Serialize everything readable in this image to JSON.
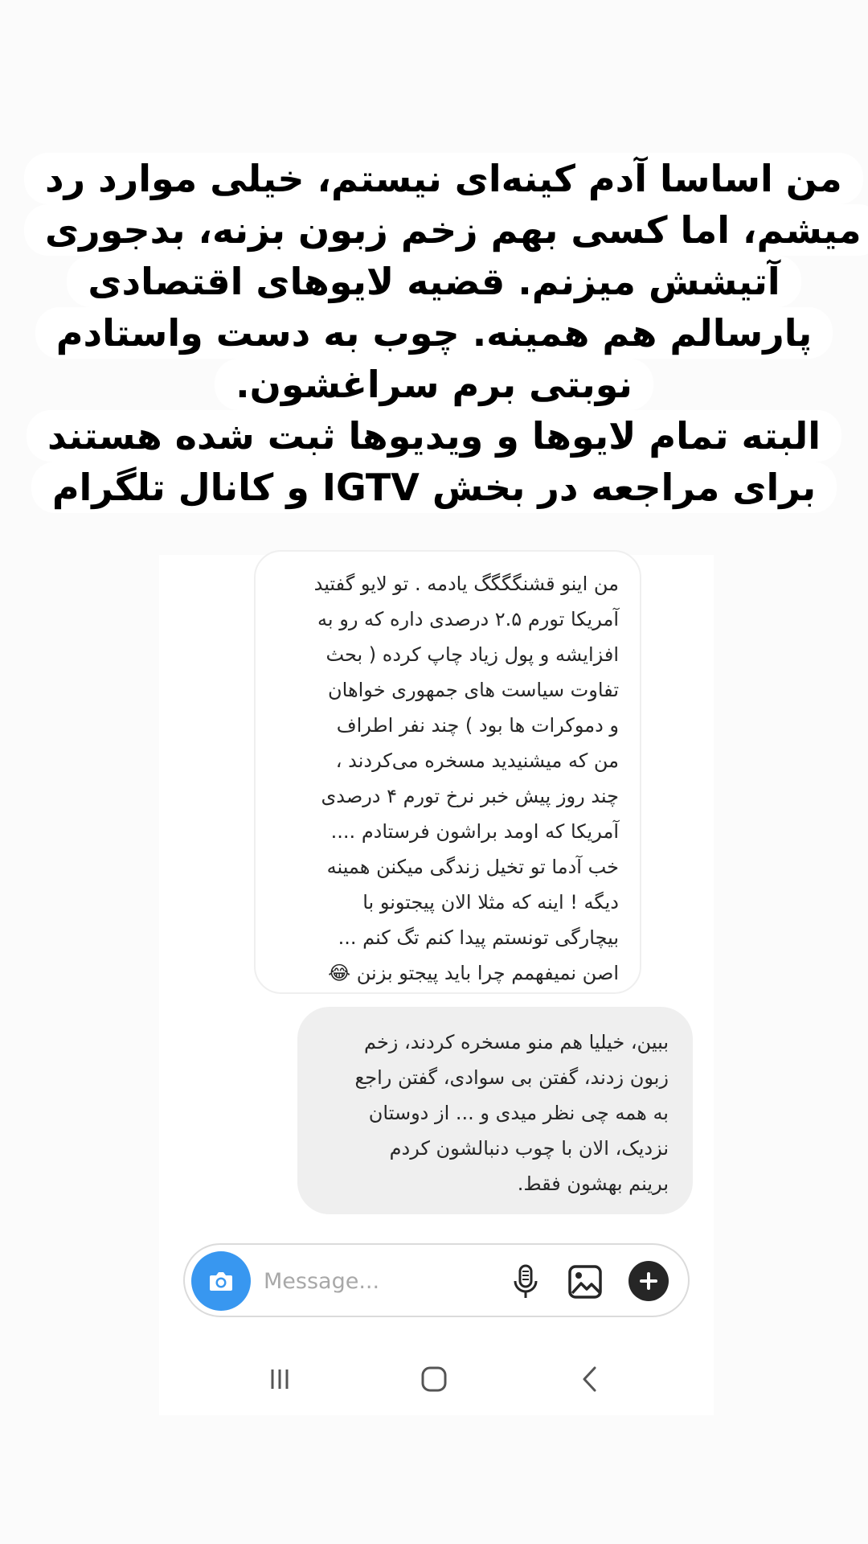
{
  "caption": {
    "lines": [
      "من اساسا آدم کینه‌ای نیستم، خیلی موارد رد",
      "میشم، اما کسی بهم زخم زبون بزنه، بدجوری",
      "آتیشش میزنم. قضیه لایوهای اقتصادی",
      "پارسالم هم همینه. چوب به دست واستادم",
      "نوبتی برم سراغشون.",
      "البته تمام لایوها و ویدیوها ثبت شده هستند",
      "برای مراجعه در بخش IGTV و کانال تلگرام"
    ]
  },
  "chat": {
    "incoming": {
      "lines": [
        "من اینو قشنگگگگ یادمه . تو لایو گفتید",
        "آمریکا تورم ۲.۵ درصدی داره که رو به",
        "افزایشه و پول زیاد چاپ کرده ( بحث",
        "تفاوت سیاست های جمهوری خواهان",
        "و دموکرات ها بود ) چند نفر اطراف",
        "من که میشنیدید مسخره می‌کردند ،",
        "چند روز پیش خبر نرخ تورم ۴ درصدی",
        "آمریکا که اومد براشون فرستادم ....",
        "خب آدما تو تخیل زندگی میکنن همینه",
        "دیگه !  اینه که مثلا الان پیجتونو با",
        "بیچارگی تونستم پیدا کنم تگ کنم ...",
        "اصن نمیفهمم چرا باید پیجتو بزنن 😂"
      ]
    },
    "outgoing": {
      "lines": [
        "ببین، خیلیا هم منو مسخره کردند، زخم",
        "زبون زدند، گفتن بی سوادی، گفتن راجع",
        "به همه چی نظر میدی و ... از دوستان",
        "نزدیک، الان با چوب دنبالشون کردم",
        "برینم بهشون فقط."
      ]
    }
  },
  "composer": {
    "placeholder": "Message...",
    "camera_icon": "camera-icon",
    "mic_icon": "microphone-icon",
    "gallery_icon": "image-gallery-icon",
    "plus_icon": "plus-icon",
    "accent_color": "#3897f0"
  },
  "navbar": {
    "recents_icon": "recent-apps-icon",
    "home_icon": "home-icon",
    "back_icon": "back-icon"
  }
}
